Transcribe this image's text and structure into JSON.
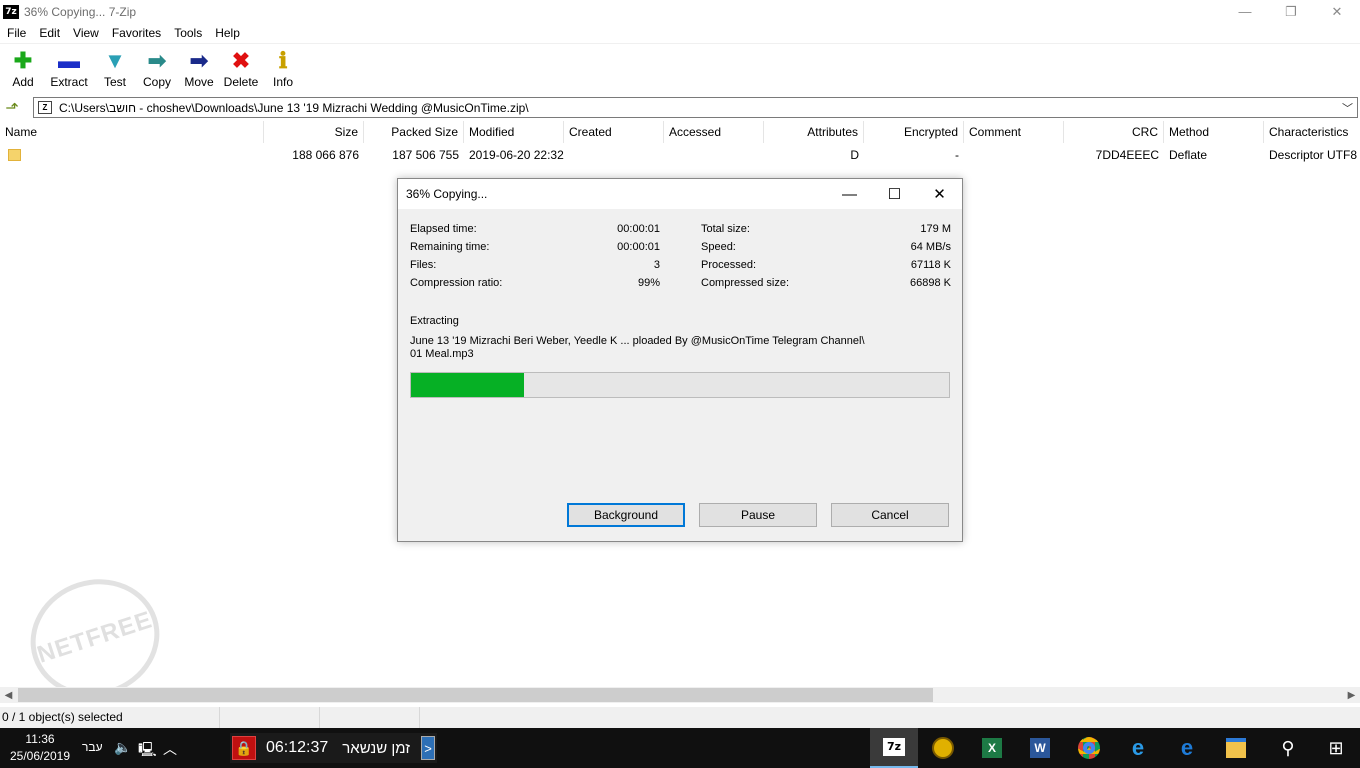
{
  "window": {
    "icon_label": "7z",
    "title": "36% Copying... 7-Zip",
    "controls": [
      "—",
      "❐",
      "✕"
    ]
  },
  "menu": [
    "File",
    "Edit",
    "View",
    "Favorites",
    "Tools",
    "Help"
  ],
  "toolbar": [
    {
      "label": "Add",
      "icon": "plus-icon",
      "glyph": "✚",
      "color": "#1aa81a"
    },
    {
      "label": "Extract",
      "icon": "minus-icon",
      "glyph": "▬",
      "color": "#1a2ec8"
    },
    {
      "label": "Test",
      "icon": "check-arrow-icon",
      "glyph": "▼",
      "color": "#2aa0b5"
    },
    {
      "label": "Copy",
      "icon": "copy-arrow-icon",
      "glyph": "➡",
      "color": "#2a8a8a"
    },
    {
      "label": "Move",
      "icon": "move-arrow-icon",
      "glyph": "➡",
      "color": "#1a2a8a"
    },
    {
      "label": "Delete",
      "icon": "delete-x-icon",
      "glyph": "✖",
      "color": "#e01010"
    },
    {
      "label": "Info",
      "icon": "info-icon",
      "glyph": "ℹ",
      "color": "#c8a000"
    }
  ],
  "address": {
    "path": "C:\\Users\\חושב - choshev\\Downloads\\June 13 '19 Mizrachi Wedding @MusicOnTime.zip\\"
  },
  "columns": [
    "Name",
    "Size",
    "Packed Size",
    "Modified",
    "Created",
    "Accessed",
    "Attributes",
    "Encrypted",
    "Comment",
    "CRC",
    "Method",
    "Characteristics"
  ],
  "rows": [
    {
      "name": "",
      "size": "188 066 876",
      "packed": "187 506 755",
      "modified": "2019-06-20 22:32",
      "created": "",
      "accessed": "",
      "attributes": "D",
      "encrypted": "-",
      "comment": "",
      "crc": "7DD4EEEC",
      "method": "Deflate",
      "characteristics": "Descriptor UTF8"
    }
  ],
  "dialog": {
    "title": "36% Copying...",
    "controls": [
      "—",
      "☐",
      "✕"
    ],
    "elapsed_label": "Elapsed time:",
    "elapsed": "00:00:01",
    "remaining_label": "Remaining time:",
    "remaining": "00:00:01",
    "files_label": "Files:",
    "files": "3",
    "ratio_label": "Compression ratio:",
    "ratio": "99%",
    "total_label": "Total size:",
    "total": "179 M",
    "speed_label": "Speed:",
    "speed": "64 MB/s",
    "processed_label": "Processed:",
    "processed": "67118 K",
    "compressed_label": "Compressed size:",
    "compressed": "66898 K",
    "action": "Extracting",
    "path_line1": "June 13 '19 Mizrachi Beri Weber, Yeedle K ... ploaded By @MusicOnTime Telegram Channel\\",
    "path_line2": "01 Meal.mp3",
    "progress_percent": 21,
    "buttons": {
      "background": "Background",
      "pause": "Pause",
      "cancel": "Cancel"
    }
  },
  "watermark": "NETFREE",
  "status": {
    "selected": "0 / 1 object(s) selected"
  },
  "taskbar": {
    "time": "11:36",
    "date": "25/06/2019",
    "language": "עבר",
    "timer_value": "06:12:37",
    "timer_label": "זמן שנשאר",
    "timer_arrow": ">",
    "apps": [
      {
        "name": "7-zip",
        "label": "7z"
      },
      {
        "name": "netfree",
        "label": ""
      },
      {
        "name": "excel",
        "label": "X"
      },
      {
        "name": "word",
        "label": "W"
      },
      {
        "name": "chrome",
        "label": ""
      },
      {
        "name": "ie",
        "label": "e"
      },
      {
        "name": "edge",
        "label": "e"
      },
      {
        "name": "explorer",
        "label": ""
      }
    ]
  }
}
